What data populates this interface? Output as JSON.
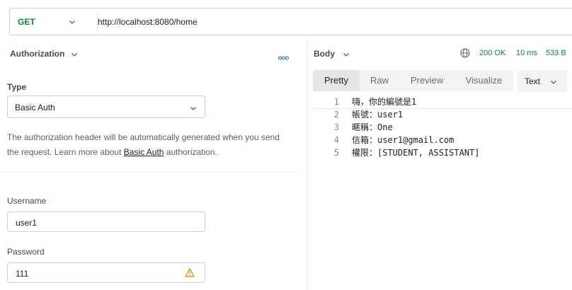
{
  "request": {
    "method": "GET",
    "url": "http://localhost:8080/home"
  },
  "auth": {
    "tab_label": "Authorization",
    "type_label": "Type",
    "type_value": "Basic Auth",
    "help_text_before": "The authorization header will be automatically generated when you send the request. Learn more about ",
    "help_link": "Basic Auth",
    "help_text_after": " authorization.",
    "username_label": "Username",
    "username_value": "user1",
    "password_label": "Password",
    "password_value": "111"
  },
  "response": {
    "body_label": "Body",
    "status": "200 OK",
    "time": "10 ms",
    "size": "533 B",
    "tabs": [
      "Pretty",
      "Raw",
      "Preview",
      "Visualize"
    ],
    "active_tab": "Pretty",
    "format": "Text",
    "lines": [
      {
        "no": "1",
        "text": "嗨，你的編號是1"
      },
      {
        "no": "2",
        "text": "帳號：user1"
      },
      {
        "no": "3",
        "text": "暱稱：One"
      },
      {
        "no": "4",
        "text": "信箱：user1@gmail.com"
      },
      {
        "no": "5",
        "text": "權限：[STUDENT, ASSISTANT]"
      }
    ]
  },
  "icons": {
    "method_dropdown": "chevron-down-icon",
    "auth_dropdown": "chevron-down-icon",
    "more": "more-horizontal-icon",
    "type_dropdown": "chevron-down-icon",
    "password_warning": "warning-icon",
    "body_dropdown": "chevron-down-icon",
    "network": "globe-icon",
    "format_dropdown": "chevron-down-icon"
  },
  "colors": {
    "method_get": "#0a8a37",
    "status_ok": "#0a8a37",
    "link_accent": "#1a73b8",
    "warning": "#c79100"
  }
}
